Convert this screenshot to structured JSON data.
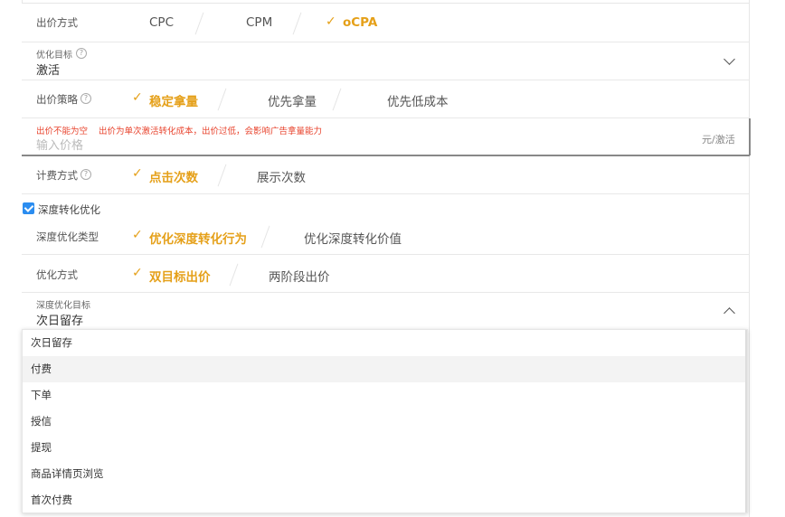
{
  "bid_method": {
    "label": "出价方式",
    "options": [
      {
        "text": "CPC",
        "selected": false
      },
      {
        "text": "CPM",
        "selected": false
      },
      {
        "text": "oCPA",
        "selected": true
      }
    ]
  },
  "optimization_goal": {
    "label": "优化目标",
    "value": "激活"
  },
  "bid_strategy": {
    "label": "出价策略",
    "options": [
      {
        "text": "稳定拿量",
        "selected": true
      },
      {
        "text": "优先拿量",
        "selected": false
      },
      {
        "text": "优先低成本",
        "selected": false
      }
    ]
  },
  "bid_price": {
    "error": "出价不能为空",
    "hint": "出价为单次激活转化成本，出价过低，会影响广告拿量能力",
    "placeholder": "输入价格",
    "unit": "元/激活"
  },
  "billing": {
    "label": "计费方式",
    "options": [
      {
        "text": "点击次数",
        "selected": true
      },
      {
        "text": "展示次数",
        "selected": false
      }
    ]
  },
  "deep_conversion": {
    "checkbox_label": "深度转化优化",
    "checked": true
  },
  "deep_type": {
    "label": "深度优化类型",
    "options": [
      {
        "text": "优化深度转化行为",
        "selected": true
      },
      {
        "text": "优化深度转化价值",
        "selected": false
      }
    ]
  },
  "opt_method": {
    "label": "优化方式",
    "options": [
      {
        "text": "双目标出价",
        "selected": true
      },
      {
        "text": "两阶段出价",
        "selected": false
      }
    ]
  },
  "deep_goal": {
    "label": "深度优化目标",
    "value": "次日留存",
    "items": [
      "次日留存",
      "付费",
      "下单",
      "授信",
      "提现",
      "商品详情页浏览",
      "首次付费"
    ],
    "hover_index": 1
  },
  "icons": {
    "check": "✓",
    "help": "?"
  },
  "colors": {
    "selected": "#e5a019",
    "error": "#e8442e",
    "checkbox": "#2b8df0"
  }
}
